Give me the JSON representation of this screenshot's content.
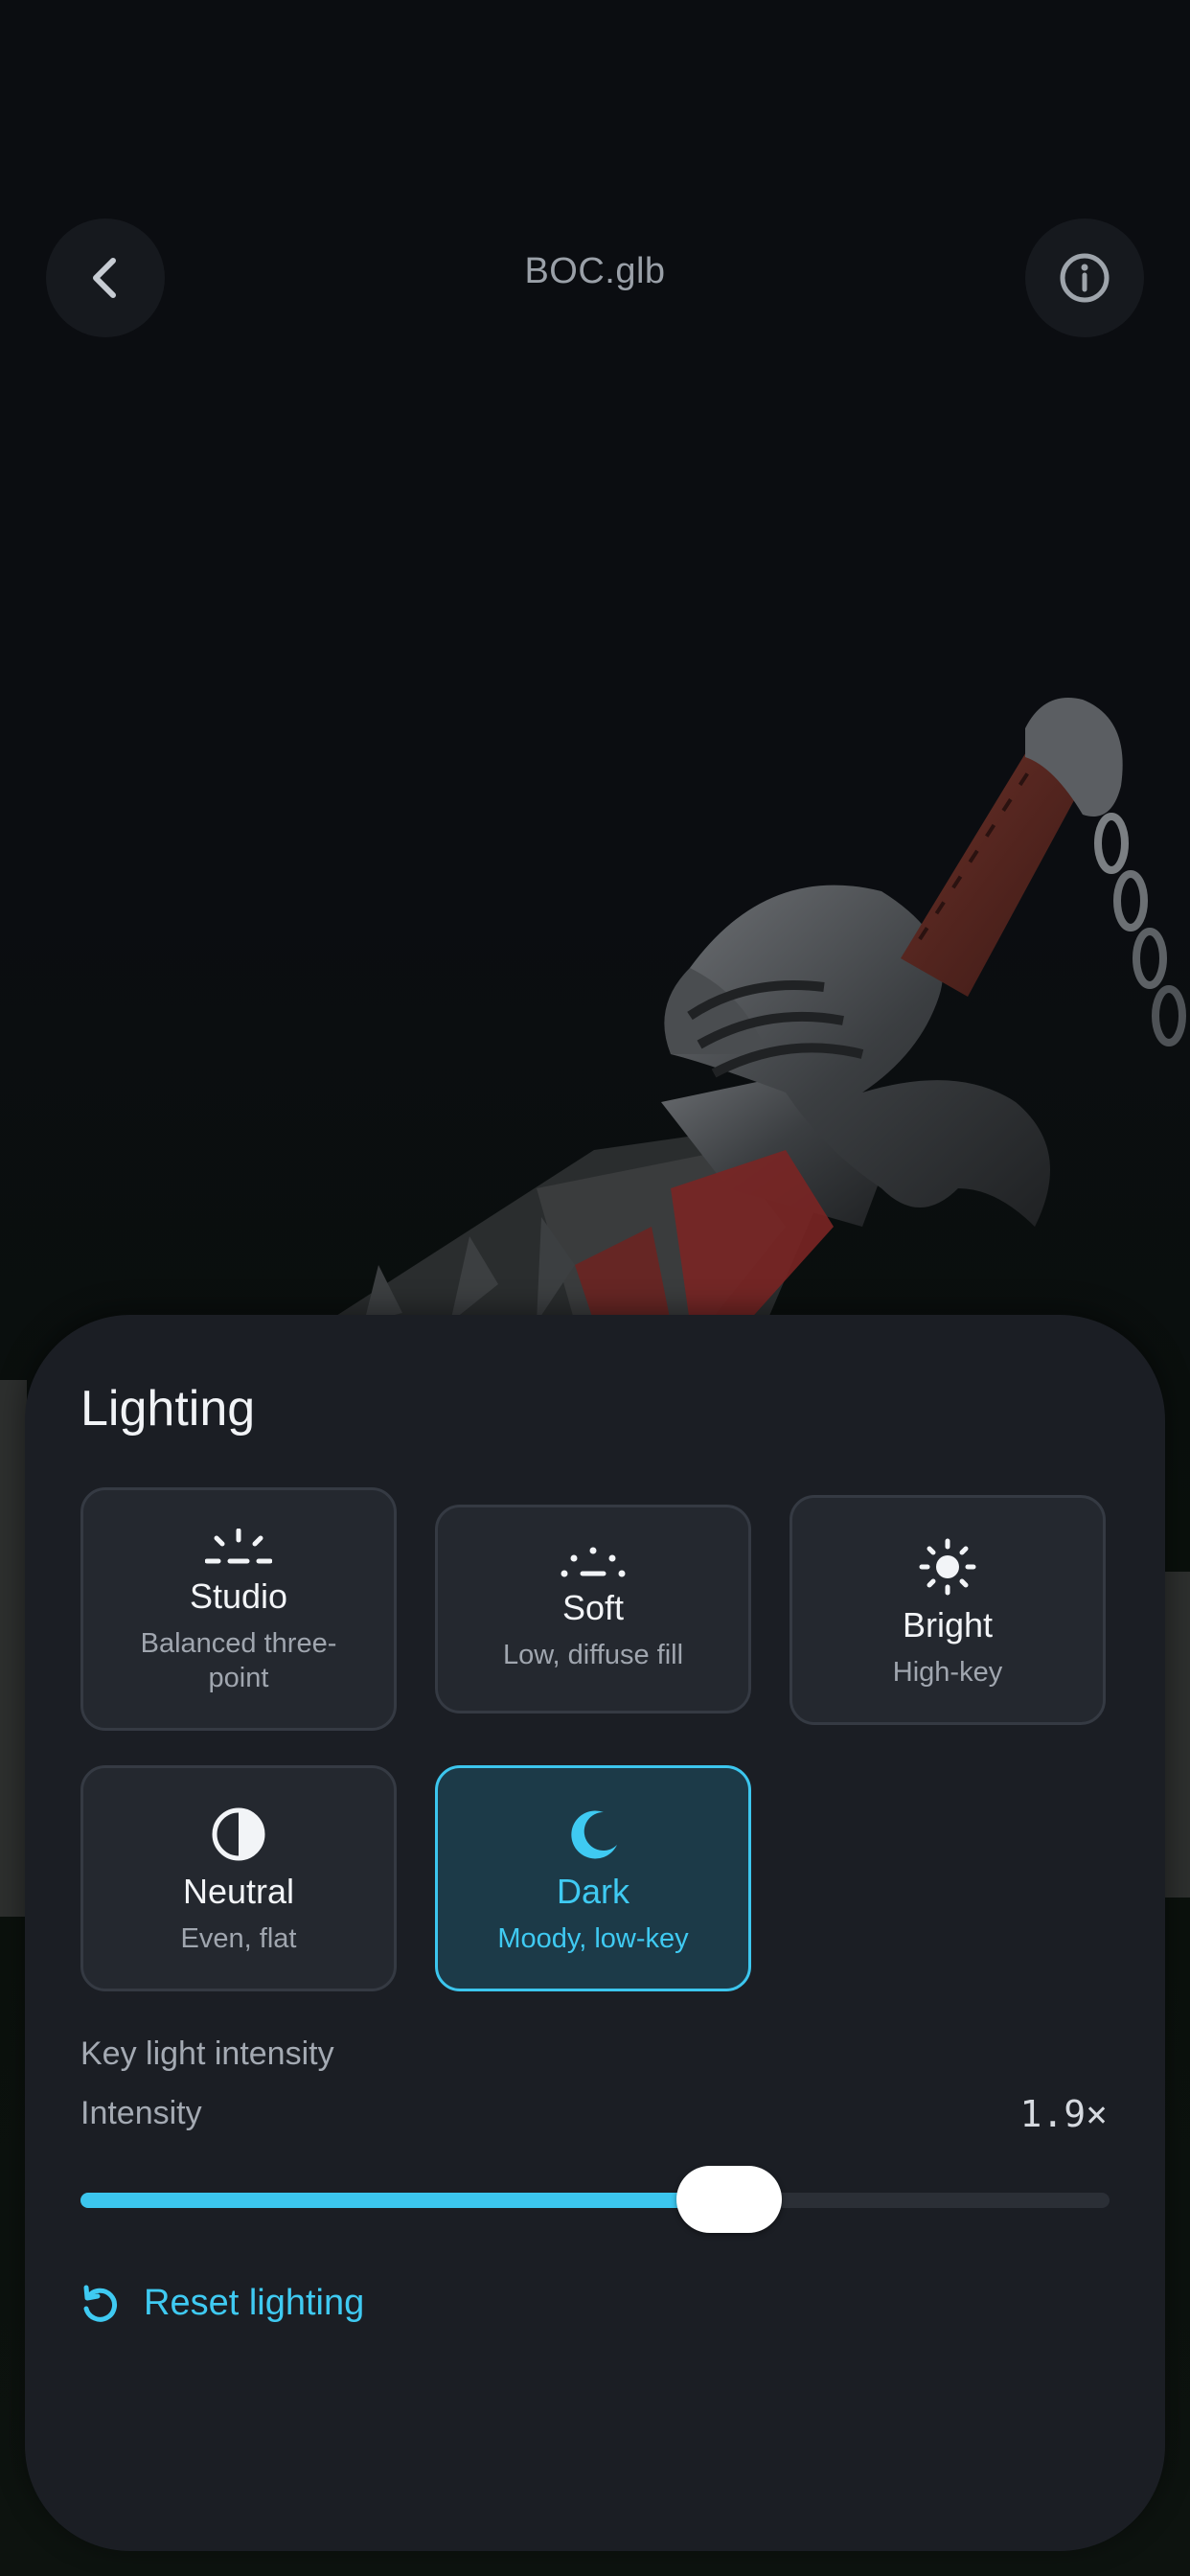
{
  "header": {
    "title": "BOC.glb",
    "back_icon": "chevron-left-icon",
    "info_icon": "info-icon"
  },
  "lighting": {
    "title": "Lighting",
    "presets": [
      {
        "name": "Studio",
        "desc": "Balanced three-point",
        "icon": "sunrise-icon",
        "selected": false
      },
      {
        "name": "Soft",
        "desc": "Low, diffuse fill",
        "icon": "soft-light-icon",
        "selected": false
      },
      {
        "name": "Bright",
        "desc": "High-key",
        "icon": "sun-icon",
        "selected": false
      },
      {
        "name": "Neutral",
        "desc": "Even, flat",
        "icon": "contrast-icon",
        "selected": false
      },
      {
        "name": "Dark",
        "desc": "Moody, low-key",
        "icon": "moon-icon",
        "selected": true
      }
    ],
    "key_light_label": "Key light intensity",
    "intensity_label": "Intensity",
    "intensity_value": "1.9×",
    "intensity_fraction": 0.63,
    "reset_label": "Reset lighting",
    "reset_icon": "rotate-ccw-icon"
  },
  "colors": {
    "accent": "#3cc6ee",
    "sheet": "#1b1e24",
    "card": "#24282f",
    "background": "#0b0d11"
  }
}
